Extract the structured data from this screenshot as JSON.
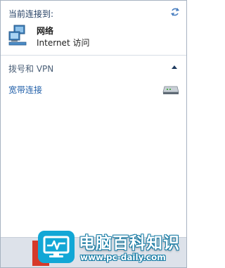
{
  "panel": {
    "connected_header": "当前连接到:",
    "network": {
      "name": "网络",
      "status": "Internet 访问"
    },
    "vpn_header": "拨号和 VPN",
    "broadband_label": "宽带连接"
  },
  "watermark": {
    "title": "电脑百科知识",
    "url": "www.pc-daily.com"
  },
  "icons": {
    "refresh": "refresh-icon",
    "network": "network-computer-icon",
    "collapse": "chevron-up-icon",
    "modem": "modem-icon",
    "watermark_logo": "monitor-pulse-logo"
  },
  "colors": {
    "link": "#1f5ea8",
    "watermark_blue": "#12a7d6"
  }
}
